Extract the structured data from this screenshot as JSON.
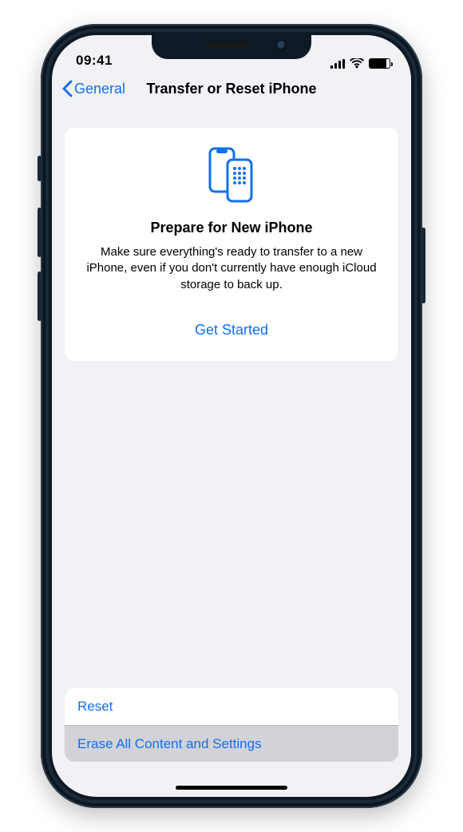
{
  "status": {
    "time": "09:41"
  },
  "nav": {
    "back_label": "General",
    "title": "Transfer or Reset iPhone"
  },
  "prepare_card": {
    "title": "Prepare for New iPhone",
    "description": "Make sure everything's ready to transfer to a new iPhone, even if you don't currently have enough iCloud storage to back up.",
    "cta_label": "Get Started"
  },
  "actions": {
    "reset_label": "Reset",
    "erase_label": "Erase All Content and Settings"
  },
  "colors": {
    "accent": "#1270ee",
    "background": "#f2f1f6",
    "card": "#ffffff",
    "selected_row": "#d2d2d7"
  }
}
